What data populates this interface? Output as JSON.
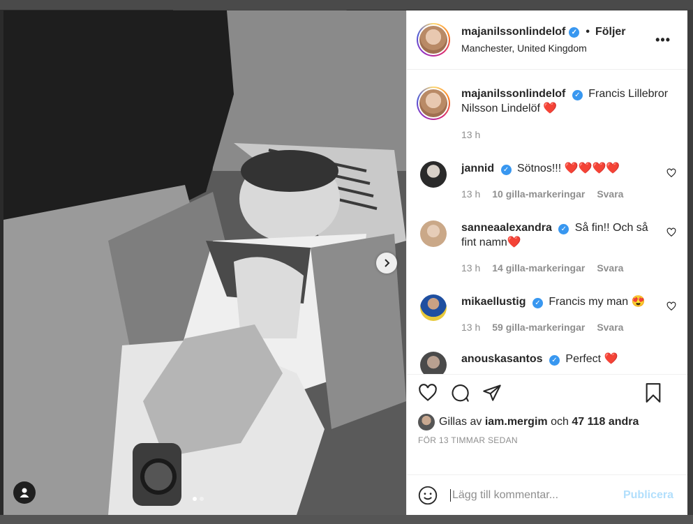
{
  "post": {
    "author": "majanilssonlindelof",
    "follow_label": "Följer",
    "separator": "•",
    "location": "Manchester, United Kingdom",
    "more_label": "•••",
    "caption_text": "Francis Lillebror Nilsson Lindelöf ❤️",
    "caption_time": "13 h"
  },
  "comments": [
    {
      "user": "jannid",
      "text": "Sötnos!!! ❤️❤️❤️❤️",
      "time": "13 h",
      "likes": "10 gilla-markeringar",
      "reply": "Svara",
      "verified": true
    },
    {
      "user": "sanneaalexandra",
      "text": "Så fin!! Och så fint namn❤️",
      "time": "13 h",
      "likes": "14 gilla-markeringar",
      "reply": "Svara",
      "verified": true
    },
    {
      "user": "mikaellustig",
      "text": "Francis my man 😍",
      "time": "13 h",
      "likes": "59 gilla-markeringar",
      "reply": "Svara",
      "verified": true
    },
    {
      "user": "anouskasantos",
      "text": "Perfect ❤️",
      "verified": true
    }
  ],
  "likes": {
    "prefix": "Gillas av",
    "liker": "iam.mergim",
    "and": "och",
    "others": "47 118 andra"
  },
  "timestamp": "FÖR 13 TIMMAR SEDAN",
  "add_comment": {
    "placeholder": "Lägg till kommentar...",
    "publish": "Publicera"
  },
  "carousel": {
    "current": 1,
    "total": 2
  },
  "icons": [
    "heart-icon",
    "comment-icon",
    "share-icon",
    "bookmark-icon",
    "next-arrow-icon",
    "user-tag-icon",
    "emoji-icon",
    "verified-icon"
  ],
  "colors": {
    "verified": "#3897f0",
    "publish_disabled": "#b2dffc",
    "muted": "#8e8e8e"
  }
}
